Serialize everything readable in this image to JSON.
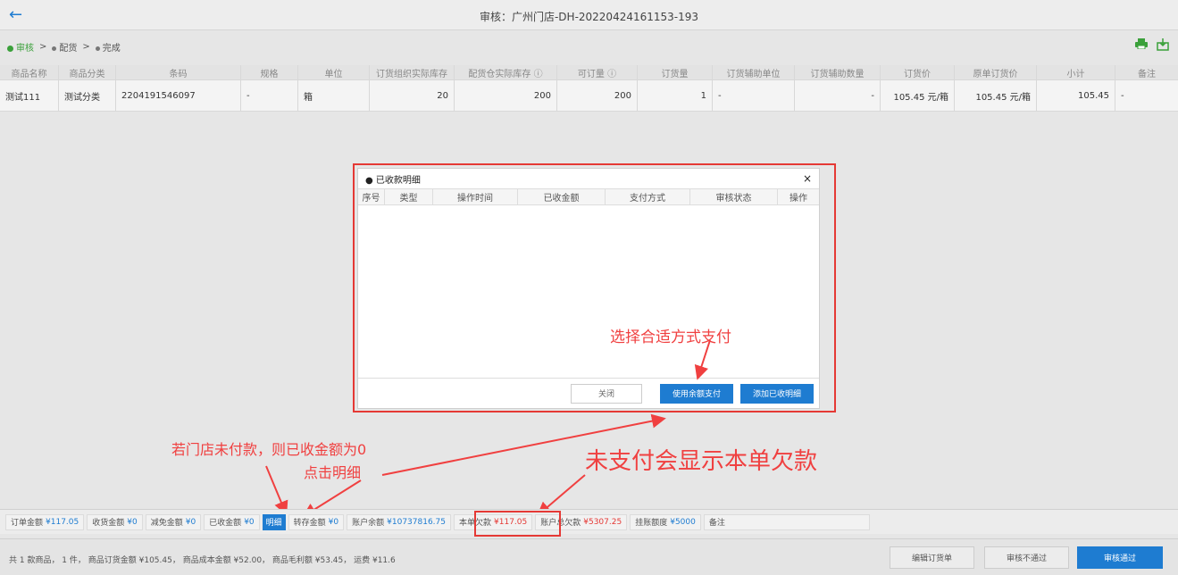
{
  "header": {
    "title": "审核：广州门店-DH-20220424161153-193"
  },
  "steps": {
    "step1": "审核",
    "step2": "配货",
    "step3": "完成",
    "sep": ">"
  },
  "table": {
    "columns": [
      "商品名称",
      "商品分类",
      "条码",
      "规格",
      "单位",
      "订货组织实际库存",
      "配货仓实际库存 ⓘ",
      "可订量 ⓘ",
      "订货量",
      "订货辅助单位",
      "订货辅助数量",
      "订货价",
      "原单订货价",
      "小计",
      "备注"
    ],
    "row": [
      "测试111",
      "测试分类",
      "2204191546097",
      "-",
      "箱",
      "20",
      "200",
      "200",
      "1",
      "-",
      "-",
      "105.45 元/箱",
      "105.45 元/箱",
      "105.45",
      "-"
    ]
  },
  "modal": {
    "title": "● 已收款明细",
    "close": "×",
    "columns": [
      "序号",
      "类型",
      "操作时间",
      "已收金额",
      "支付方式",
      "审核状态",
      "操作"
    ],
    "buttons": {
      "close": "关闭",
      "balance_pay": "使用余额支付",
      "add_detail": "添加已收明细"
    }
  },
  "annotations": {
    "choose_pay": "选择合适方式支付",
    "unpaid_line1": "若门店未付款，则已收金额为0",
    "unpaid_line2": "点击明细",
    "arrears": "未支付会显示本单欠款"
  },
  "summary": {
    "order_amount_label": "订单金额",
    "order_amount": "¥117.05",
    "received_label": "收货金额",
    "received": "¥0",
    "discount_label": "减免金额",
    "discount": "¥0",
    "paid_label": "已收金额",
    "paid": "¥0",
    "detail_btn": "明细",
    "transfer_label": "转存金额",
    "transfer": "¥0",
    "balance_label": "账户余额",
    "balance": "¥10737816.75",
    "arrears_label": "本单欠款",
    "arrears": "¥117.05",
    "total_arrears_label": "账户总欠款",
    "total_arrears": "¥5307.25",
    "credit_label": "挂账额度",
    "credit": "¥5000",
    "remark_label": "备注"
  },
  "footer": {
    "info": "共 1 款商品， 1 件， 商品订货金额 ¥105.45， 商品成本金额 ¥52.00， 商品毛利额 ¥53.45， 运费 ¥11.6",
    "edit_btn": "编辑订货单",
    "reject_btn": "审核不通过",
    "approve_btn": "审核通过"
  },
  "colors": {
    "accent": "#1e7cd1",
    "annotation": "#f04040",
    "step_active": "#3aa03a"
  }
}
